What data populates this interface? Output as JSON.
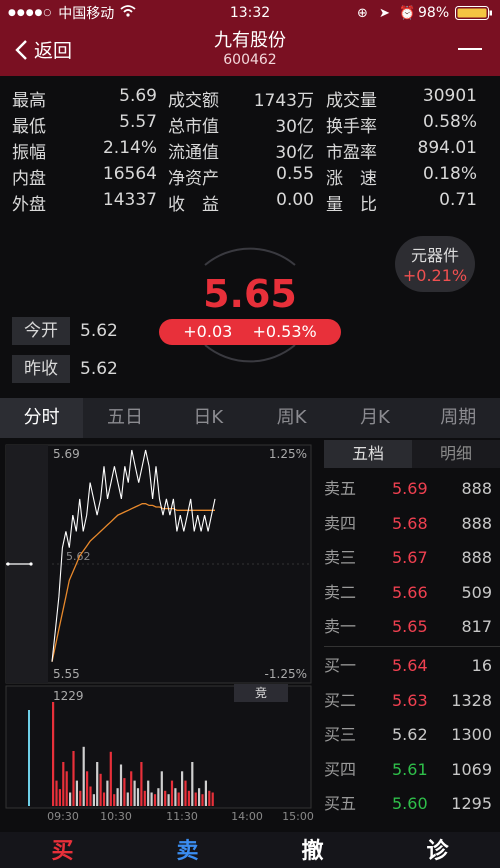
{
  "status": {
    "carrier": "中国移动",
    "time": "13:32",
    "battery": "98%"
  },
  "nav": {
    "back_label": "返回",
    "title": "九有股份",
    "code": "600462"
  },
  "stats": [
    {
      "l1": "最高",
      "v1": "5.69",
      "l2": "成交额",
      "v2": "1743万",
      "l3": "成交量",
      "v3": "30901"
    },
    {
      "l1": "最低",
      "v1": "5.57",
      "l2": "总市值",
      "v2": "30亿",
      "l3": "换手率",
      "v3": "0.58%"
    },
    {
      "l1": "振幅",
      "v1": "2.14%",
      "l2": "流通值",
      "v2": "30亿",
      "l3": "市盈率",
      "v3": "894.01"
    },
    {
      "l1": "内盘",
      "v1": "16564",
      "l2": "净资产",
      "v2": "0.55",
      "l3": "涨　速",
      "v3": "0.18%"
    },
    {
      "l1": "外盘",
      "v1": "14337",
      "l2": "收　益",
      "v2": "0.00",
      "l3": "量　比",
      "v3": "0.71"
    }
  ],
  "quote": {
    "price": "5.65",
    "change": "+0.03",
    "change_pct": "+0.53%"
  },
  "sector": {
    "name": "元器件",
    "pct": "+0.21%"
  },
  "open": {
    "label": "今开",
    "value": "5.62"
  },
  "prev_close": {
    "label": "昨收",
    "value": "5.62"
  },
  "tabs": [
    "分时",
    "五日",
    "日K",
    "周K",
    "月K",
    "周期"
  ],
  "orderbook": {
    "tabs": [
      "五档",
      "明细"
    ],
    "rows": [
      {
        "label": "卖五",
        "price": "5.69",
        "vol": "888",
        "color": "#ef4050"
      },
      {
        "label": "卖四",
        "price": "5.68",
        "vol": "888",
        "color": "#ef4050"
      },
      {
        "label": "卖三",
        "price": "5.67",
        "vol": "888",
        "color": "#ef4050"
      },
      {
        "label": "卖二",
        "price": "5.66",
        "vol": "509",
        "color": "#ef4050"
      },
      {
        "label": "卖一",
        "price": "5.65",
        "vol": "817",
        "color": "#ef4050"
      },
      {
        "label": "买一",
        "price": "5.64",
        "vol": "16",
        "color": "#ef4050"
      },
      {
        "label": "买二",
        "price": "5.63",
        "vol": "1328",
        "color": "#ef4050"
      },
      {
        "label": "买三",
        "price": "5.62",
        "vol": "1300",
        "color": "#c8c8c8"
      },
      {
        "label": "买四",
        "price": "5.61",
        "vol": "1069",
        "color": "#2fbf4a"
      },
      {
        "label": "买五",
        "price": "5.60",
        "vol": "1295",
        "color": "#2fbf4a"
      }
    ]
  },
  "chart_data": {
    "type": "line",
    "price_top": "5.69",
    "price_bottom": "5.55",
    "pct_top": "1.25%",
    "pct_bottom": "-1.25%",
    "mid_label": "5.62",
    "volume_max": "1229",
    "auction_label": "竞",
    "x_labels": [
      "09:30",
      "10:30",
      "11:30",
      "14:00",
      "15:00"
    ],
    "price": [
      5.56,
      5.58,
      5.6,
      5.63,
      5.64,
      5.63,
      5.65,
      5.64,
      5.66,
      5.64,
      5.65,
      5.67,
      5.66,
      5.65,
      5.66,
      5.68,
      5.66,
      5.67,
      5.68,
      5.67,
      5.66,
      5.68,
      5.67,
      5.69,
      5.68,
      5.67,
      5.68,
      5.69,
      5.68,
      5.66,
      5.68,
      5.66,
      5.65,
      5.66,
      5.65,
      5.66,
      5.64,
      5.65,
      5.64,
      5.65,
      5.66,
      5.64,
      5.65,
      5.64,
      5.65,
      5.64,
      5.65,
      5.66
    ],
    "avg": [
      5.56,
      5.57,
      5.58,
      5.59,
      5.6,
      5.61,
      5.615,
      5.62,
      5.625,
      5.628,
      5.631,
      5.634,
      5.636,
      5.638,
      5.64,
      5.642,
      5.644,
      5.646,
      5.648,
      5.65,
      5.651,
      5.652,
      5.653,
      5.654,
      5.655,
      5.656,
      5.657,
      5.657,
      5.656,
      5.656,
      5.655,
      5.655,
      5.654,
      5.654,
      5.654,
      5.654,
      5.653,
      5.653,
      5.653,
      5.653,
      5.653,
      5.653,
      5.653,
      5.653,
      5.653,
      5.653,
      5.653,
      5.653
    ],
    "volume": [
      1229,
      300,
      200,
      520,
      410,
      160,
      650,
      300,
      180,
      700,
      410,
      230,
      140,
      520,
      380,
      160,
      300,
      640,
      140,
      210,
      490,
      330,
      160,
      410,
      300,
      210,
      520,
      180,
      300,
      160,
      140,
      210,
      410,
      180,
      140,
      300,
      210,
      160,
      410,
      300,
      180,
      520,
      160,
      210,
      140,
      300,
      180,
      160
    ]
  },
  "bottom_actions": [
    {
      "label": "买",
      "color": "#e8303a"
    },
    {
      "label": "卖",
      "color": "#3b8df0"
    },
    {
      "label": "撤",
      "color": "#ffffff"
    },
    {
      "label": "诊",
      "color": "#ffffff"
    }
  ]
}
